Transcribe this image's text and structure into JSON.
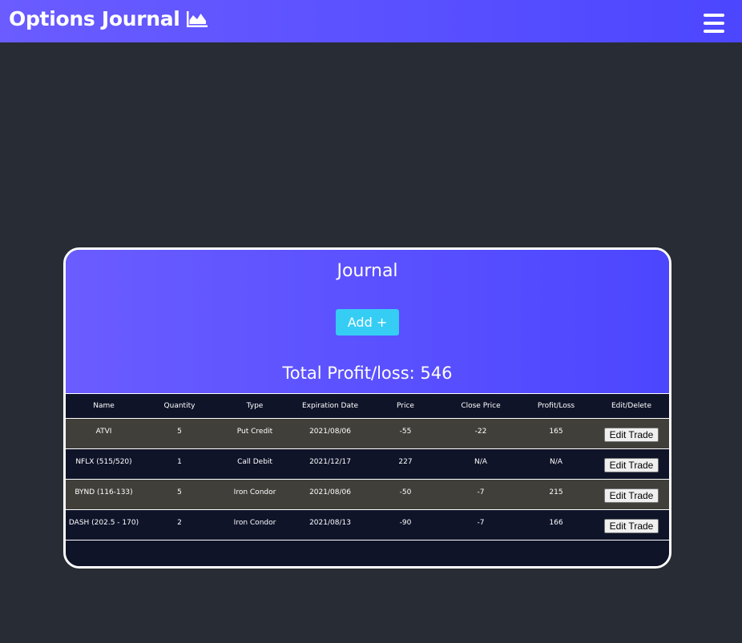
{
  "app": {
    "title": "Options Journal",
    "brand_icon": "area-chart-icon",
    "menu_icon": "hamburger-menu-icon"
  },
  "colors": {
    "page_bg": "#282c34",
    "gradient_start": "#6a5cff",
    "gradient_end": "#4c46ff",
    "add_button": "#36cdf5",
    "row_odd": "#413f3a",
    "row_even": "#0f1429"
  },
  "journal": {
    "title": "Journal",
    "add_label": "Add +",
    "total_label": "Total Profit/loss: 546",
    "columns": [
      "Name",
      "Quantity",
      "Type",
      "Expiration Date",
      "Price",
      "Close Price",
      "Profit/Loss",
      "Edit/Delete"
    ],
    "rows": [
      {
        "name": "ATVI",
        "quantity": "5",
        "type": "Put Credit",
        "expiration": "2021/08/06",
        "price": "-55",
        "close_price": "-22",
        "pl": "165",
        "edit_label": "Edit Trade"
      },
      {
        "name": "NFLX (515/520)",
        "quantity": "1",
        "type": "Call Debit",
        "expiration": "2021/12/17",
        "price": "227",
        "close_price": "N/A",
        "pl": "N/A",
        "edit_label": "Edit Trade"
      },
      {
        "name": "BYND (116-133)",
        "quantity": "5",
        "type": "Iron Condor",
        "expiration": "2021/08/06",
        "price": "-50",
        "close_price": "-7",
        "pl": "215",
        "edit_label": "Edit Trade"
      },
      {
        "name": "DASH (202.5 - 170)",
        "quantity": "2",
        "type": "Iron Condor",
        "expiration": "2021/08/13",
        "price": "-90",
        "close_price": "-7",
        "pl": "166",
        "edit_label": "Edit Trade"
      }
    ]
  }
}
